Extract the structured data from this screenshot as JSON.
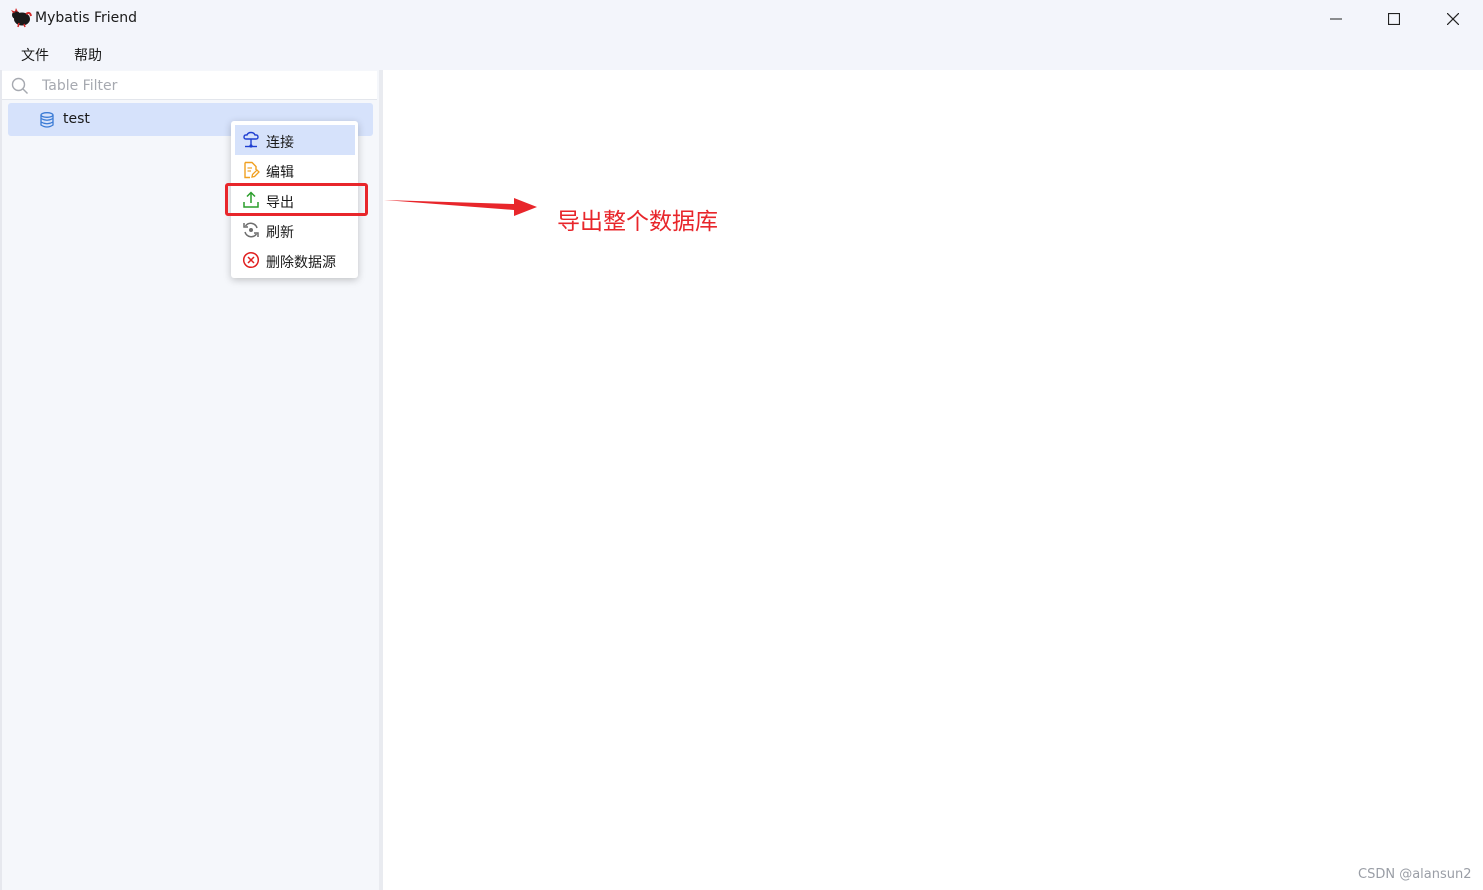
{
  "window": {
    "title": "Mybatis Friend",
    "controls": [
      "minimize-icon",
      "maximize-icon",
      "close-icon"
    ]
  },
  "menubar": {
    "file": "文件",
    "help": "帮助"
  },
  "sidebar": {
    "filter": {
      "placeholder": "Table Filter",
      "value": ""
    },
    "tree": [
      {
        "label": "test",
        "icon": "database-icon",
        "selected": true
      }
    ]
  },
  "context_menu": {
    "items": [
      {
        "label": "连接",
        "icon": "connect-icon",
        "color": "#1f3fd1",
        "hovered": true
      },
      {
        "label": "编辑",
        "icon": "edit-file-icon",
        "color": "#f0a020"
      },
      {
        "label": "导出",
        "icon": "export-icon",
        "color": "#2a9d2a"
      },
      {
        "label": "刷新",
        "icon": "refresh-icon",
        "color": "#6e6e6e"
      },
      {
        "label": "删除数据源",
        "icon": "delete-icon",
        "color": "#e02020"
      }
    ]
  },
  "annotation": {
    "text": "导出整个数据库",
    "color": "#e8262b"
  },
  "watermark": "CSDN @alansun2",
  "colors": {
    "selection": "#d6e2fb",
    "chrome": "#f3f5fb",
    "sidebar_bg": "#f5f7fb"
  }
}
